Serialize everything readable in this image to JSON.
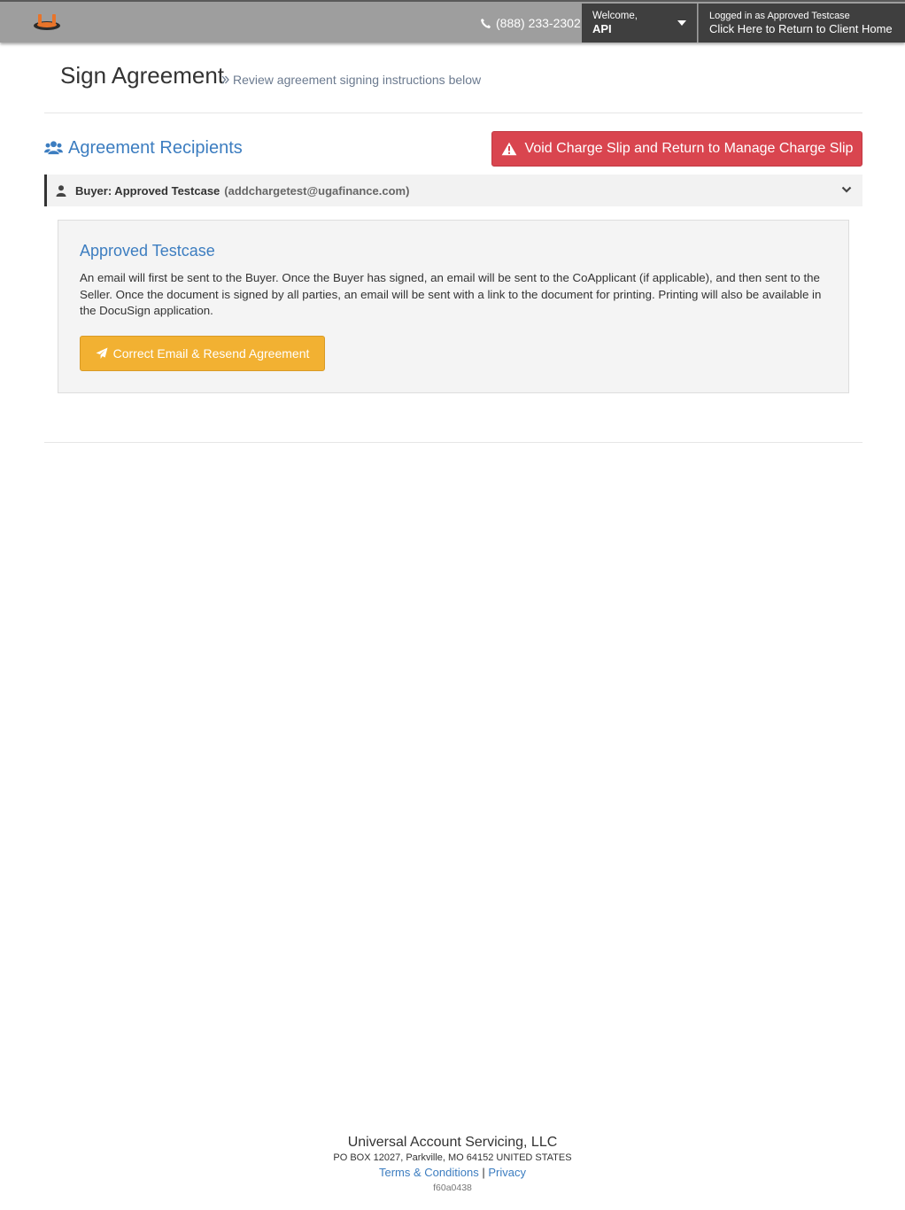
{
  "navbar": {
    "logo_icon": "brand-logo-icon",
    "phone_icon": "phone-icon",
    "phone": "(888) 233-2302",
    "welcome_label": "Welcome,",
    "welcome_user": "API",
    "logged_in_label": "Logged in as Approved Testcase",
    "return_link": "Click Here to Return to Client Home"
  },
  "header": {
    "title": "Sign Agreement",
    "breadcrumb_icon": "double-chevron-right-icon",
    "subtitle": "Review agreement signing instructions below"
  },
  "recipients": {
    "icon": "users-icon",
    "title": "Agreement Recipients",
    "void_button": "Void Charge Slip and Return to Manage Charge Slip",
    "void_icon": "warning-icon",
    "buyer_label": "Buyer: Approved Testcase",
    "buyer_email": "(addchargetest@ugafinance.com)"
  },
  "panel": {
    "name": "Approved Testcase",
    "instructions": "An email will first be sent to the Buyer. Once the Buyer has signed, an email will be sent to the CoApplicant (if applicable), and then sent to the Seller. Once the document is signed by all parties, an email will be sent with a link to the document for printing. Printing will also be available in the DocuSign application.",
    "resend_button": "Correct Email & Resend Agreement",
    "resend_icon": "paper-plane-icon"
  },
  "footer": {
    "company": "Universal Account Servicing, LLC",
    "address": "PO BOX 12027, Parkville, MO 64152 UNITED STATES",
    "terms": "Terms & Conditions",
    "separator": "|",
    "privacy": "Privacy",
    "build": "f60a0438"
  },
  "colors": {
    "navbar": "#9e9e9e",
    "navbar_dark": "#3f3f3f",
    "link_blue": "#3c7dc0",
    "danger": "#d9454f",
    "warning": "#f2b132"
  }
}
